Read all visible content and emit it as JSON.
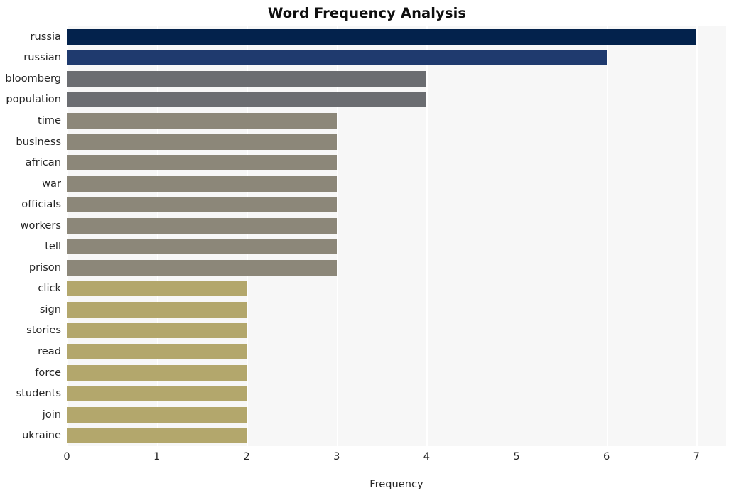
{
  "chart_data": {
    "type": "bar",
    "orientation": "horizontal",
    "title": "Word Frequency Analysis",
    "xlabel": "Frequency",
    "ylabel": "",
    "xlim": [
      0,
      7.33
    ],
    "xticks": [
      0,
      1,
      2,
      3,
      4,
      5,
      6,
      7
    ],
    "xtick_labels": [
      "0",
      "1",
      "2",
      "3",
      "4",
      "5",
      "6",
      "7"
    ],
    "grid": "vertical",
    "legend": "none",
    "plot_background": "#f7f7f7",
    "figure_background": "#ffffff",
    "gridline_color": "#ffffff",
    "categories": [
      "russia",
      "russian",
      "bloomberg",
      "population",
      "time",
      "business",
      "african",
      "war",
      "officials",
      "workers",
      "tell",
      "prison",
      "click",
      "sign",
      "stories",
      "read",
      "force",
      "students",
      "join",
      "ukraine"
    ],
    "values": [
      7,
      6,
      4,
      4,
      3,
      3,
      3,
      3,
      3,
      3,
      3,
      3,
      2,
      2,
      2,
      2,
      2,
      2,
      2,
      2
    ],
    "bar_colors": [
      "#03224c",
      "#1f3a6e",
      "#6b6d71",
      "#6b6d71",
      "#8c8779",
      "#8c8779",
      "#8c8779",
      "#8c8779",
      "#8c8779",
      "#8c8779",
      "#8c8779",
      "#8c8779",
      "#b3a76c",
      "#b3a76c",
      "#b3a76c",
      "#b3a76c",
      "#b3a76c",
      "#b3a76c",
      "#b3a76c",
      "#b3a76c"
    ]
  }
}
